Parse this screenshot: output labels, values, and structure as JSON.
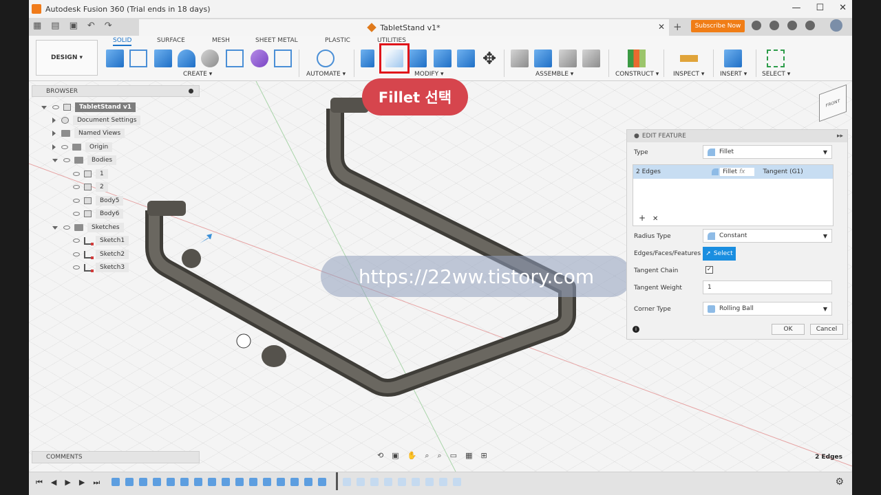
{
  "window": {
    "title": "Autodesk Fusion 360 (Trial ends in 18 days)",
    "controls": [
      "—",
      "☐",
      "✕"
    ]
  },
  "tabbar": {
    "doc_title": "TabletStand v1*",
    "close": "✕",
    "plus": "+",
    "subscribe": "Subscribe Now"
  },
  "ribbon": {
    "workspace": "DESIGN ▾",
    "tabs": [
      "SOLID",
      "SURFACE",
      "MESH",
      "SHEET METAL",
      "PLASTIC",
      "UTILITIES"
    ],
    "groups": [
      "CREATE ▾",
      "AUTOMATE ▾",
      "MODIFY ▾",
      "ASSEMBLE ▾",
      "CONSTRUCT ▾",
      "INSPECT ▾",
      "INSERT ▾",
      "SELECT ▾"
    ]
  },
  "callout": "Fillet 선택",
  "browser": {
    "title": "BROWSER",
    "items": [
      {
        "label": "TabletStand v1",
        "level": 0
      },
      {
        "label": "Document Settings",
        "level": 1
      },
      {
        "label": "Named Views",
        "level": 1
      },
      {
        "label": "Origin",
        "level": 1
      },
      {
        "label": "Bodies",
        "level": 1
      },
      {
        "label": "1",
        "level": 2
      },
      {
        "label": "2",
        "level": 2
      },
      {
        "label": "Body5",
        "level": 2
      },
      {
        "label": "Body6",
        "level": 2
      },
      {
        "label": "Sketches",
        "level": 1
      },
      {
        "label": "Sketch1",
        "level": 2
      },
      {
        "label": "Sketch2",
        "level": 2
      },
      {
        "label": "Sketch3",
        "level": 2
      }
    ]
  },
  "watermark": "https://22ww.tistory.com",
  "edit_feature": {
    "title": "EDIT FEATURE",
    "type_label": "Type",
    "type_value": "Fillet",
    "edges_row": {
      "count": "2 Edges",
      "name": "Fillet",
      "fx": "fx",
      "tangent": "Tangent (G1)"
    },
    "add": "+",
    "remove": "✕",
    "radius_type_label": "Radius Type",
    "radius_type_value": "Constant",
    "eff_label": "Edges/Faces/Features",
    "select_btn": "Select",
    "tangent_chain_label": "Tangent Chain",
    "tangent_weight_label": "Tangent Weight",
    "tangent_weight_value": "1",
    "corner_type_label": "Corner Type",
    "corner_type_value": "Rolling Ball",
    "ok": "OK",
    "cancel": "Cancel"
  },
  "comments": "COMMENTS",
  "status": "2 Edges"
}
